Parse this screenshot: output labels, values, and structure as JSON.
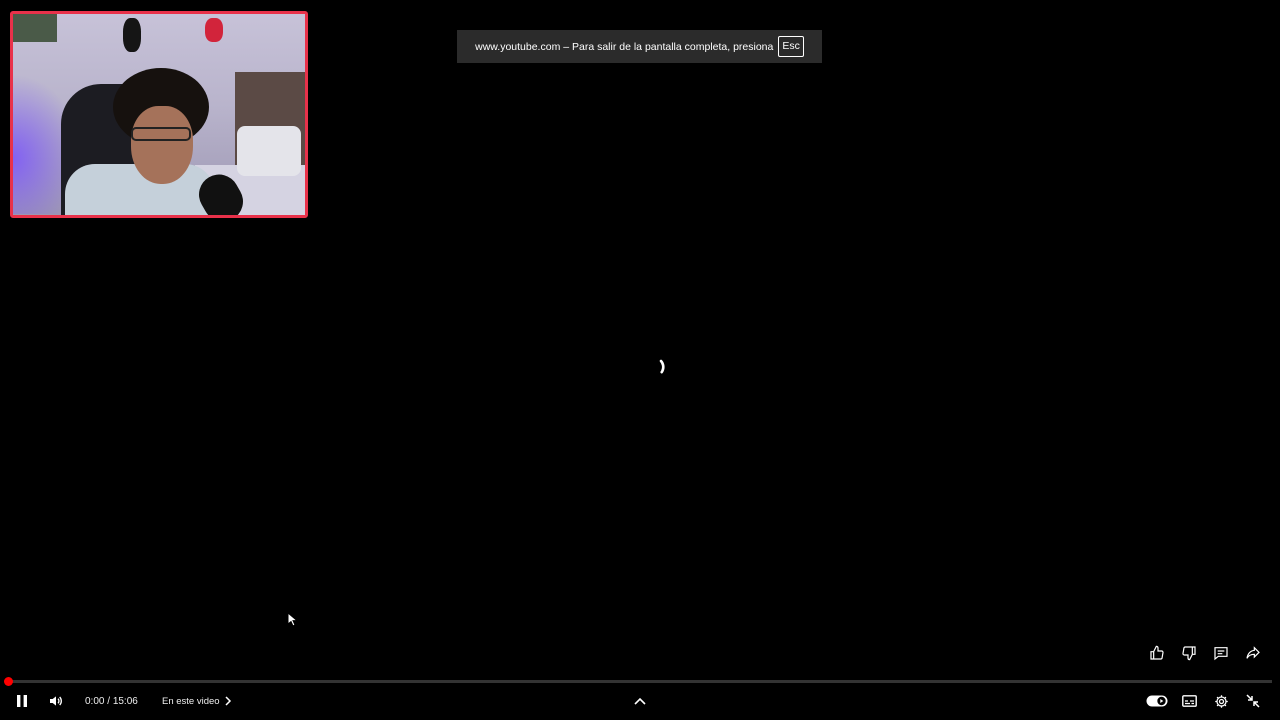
{
  "notification": {
    "message": "www.youtube.com – Para salir de la pantalla completa, presiona",
    "key": "Esc"
  },
  "player": {
    "current_time": "0:00",
    "separator": " / ",
    "duration": "15:06",
    "chapter_label": "En este video",
    "progress_fraction": 0.0,
    "state": "loading"
  },
  "icons": {
    "play_pause": "pause-icon",
    "volume": "volume-icon",
    "chapter_arrow": "chevron-right-icon",
    "expand": "chevron-up-icon",
    "autoplay": "autoplay-toggle-icon",
    "subtitles": "subtitles-icon",
    "settings": "gear-icon",
    "exit_fullscreen": "exit-fullscreen-icon",
    "like": "thumbs-up-icon",
    "dislike": "thumbs-down-icon",
    "comments": "comments-icon",
    "share": "share-icon"
  },
  "colors": {
    "accent": "#ff0000",
    "webcam_border": "#e8314a",
    "toast_bg": "#2b2b2b"
  }
}
